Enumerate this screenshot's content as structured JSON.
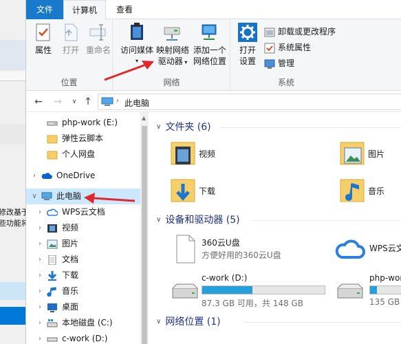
{
  "ribbon_tabs": {
    "file": "文件",
    "computer": "计算机",
    "view": "查看"
  },
  "location_group": {
    "label": "位置",
    "properties": "属性",
    "open": "打开",
    "rename": "重命名"
  },
  "network_group": {
    "label": "网络",
    "access_media": "访问媒体",
    "map_drive_line1": "映射网络",
    "map_drive_line2": "驱动器",
    "add_location_line1": "添加一个",
    "add_location_line2": "网络位置"
  },
  "system_group": {
    "label": "系统",
    "open_settings_line1": "打开",
    "open_settings_line2": "设置",
    "uninstall": "卸载或更改程序",
    "system_properties": "系统属性",
    "manage": "管理"
  },
  "address_bar": {
    "location": "此电脑"
  },
  "background_window": {
    "line1": "修改基于",
    "line2": "些功能将"
  },
  "nav_pane": {
    "items": [
      {
        "label": "php-work (E:)"
      },
      {
        "label": "弹性云脚本"
      },
      {
        "label": "个人网盘"
      },
      {
        "label": "OneDrive"
      },
      {
        "label": "此电脑"
      },
      {
        "label": "WPS云文档"
      },
      {
        "label": "视频"
      },
      {
        "label": "图片"
      },
      {
        "label": "文档"
      },
      {
        "label": "下载"
      },
      {
        "label": "音乐"
      },
      {
        "label": "桌面"
      },
      {
        "label": "本地磁盘 (C:)"
      },
      {
        "label": "c-work (D:)"
      }
    ]
  },
  "content": {
    "folders_header": "文件夹 (6)",
    "folders": [
      {
        "label": "视频"
      },
      {
        "label": "图片"
      },
      {
        "label": "下载"
      },
      {
        "label": "音乐"
      }
    ],
    "devices_header": "设备和驱动器 (5)",
    "devices": [
      {
        "label": "360云U盘",
        "sub": "方便好用的360云U盘"
      },
      {
        "label": "WPS云文"
      },
      {
        "label": "c-work (D:)",
        "sub": "87.3 GB 可用，共 148 GB",
        "used_fraction": 0.41
      },
      {
        "label": "php-wor",
        "sub": "135 GB"
      }
    ],
    "network_header": "网络位置 (1)"
  },
  "colors": {
    "accent": "#1979ca",
    "selection": "#cce8ff",
    "section_header": "#1e3287",
    "drive_bar": "#26a0da",
    "arrow": "#e0282c"
  }
}
